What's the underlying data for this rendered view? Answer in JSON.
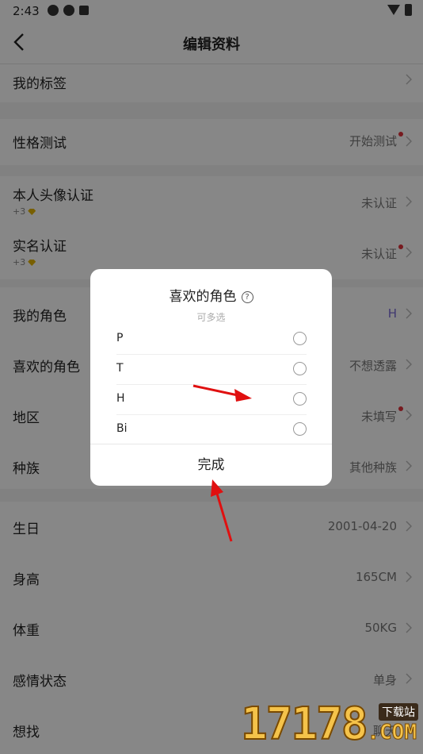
{
  "status_bar": {
    "time": "2:43"
  },
  "nav": {
    "title": "编辑资料"
  },
  "rows": [
    {
      "label": "我的标签",
      "value": ""
    },
    {
      "label": "性格测试",
      "value": "开始测试"
    },
    {
      "label": "本人头像认证",
      "sub": "+3",
      "value": "未认证"
    },
    {
      "label": "实名认证",
      "sub": "+3",
      "value": "未认证"
    },
    {
      "label": "我的角色",
      "value": "H"
    },
    {
      "label": "喜欢的角色",
      "value": "不想透露"
    },
    {
      "label": "地区",
      "value": "未填写"
    },
    {
      "label": "种族",
      "value": "其他种族"
    },
    {
      "label": "生日",
      "value": "2001-04-20"
    },
    {
      "label": "身高",
      "value": "165CM"
    },
    {
      "label": "体重",
      "value": "50KG"
    },
    {
      "label": "感情状态",
      "value": "单身"
    },
    {
      "label": "想找",
      "value": "聊天"
    }
  ],
  "dialog": {
    "title": "喜欢的角色",
    "help_glyph": "?",
    "subtitle": "可多选",
    "options": [
      {
        "label": "P",
        "selected": false
      },
      {
        "label": "T",
        "selected": false
      },
      {
        "label": "H",
        "selected": false
      },
      {
        "label": "Bi",
        "selected": false
      }
    ],
    "done_label": "完成"
  },
  "watermark": {
    "number": "17178",
    "tag": "下载站",
    "domain": ".COM"
  },
  "colors": {
    "accent_purple": "#7a6bd6",
    "red_dot": "#e0313b",
    "annotation_arrow": "#e01010"
  }
}
